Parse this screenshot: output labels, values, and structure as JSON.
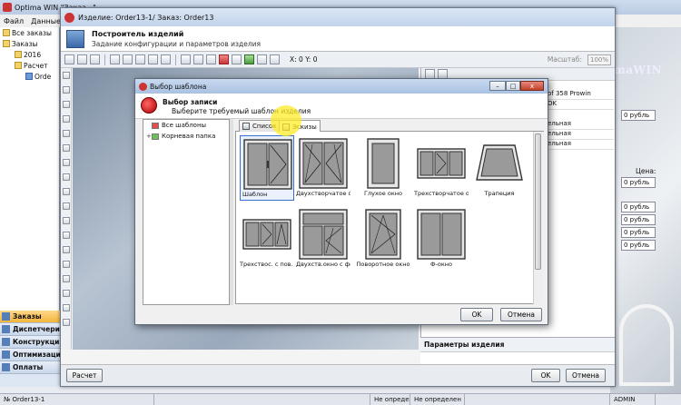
{
  "app": {
    "title": "Optima WIN \"Заказ...\"",
    "menu": [
      "Файл",
      "Данные"
    ],
    "tree": [
      "Все заказы",
      "Заказы",
      "2016",
      "Расчет",
      "Orde"
    ],
    "nav": [
      "Заказы",
      "Диспетчериза",
      "Конструкция",
      "Оптимизация",
      "Оплаты"
    ],
    "status": [
      "№ Order13-1",
      "Не определен",
      "Не определен",
      "ADMIN"
    ],
    "brand": "maWIN"
  },
  "builder": {
    "title": "Изделие: Order13-1/ Заказ: Order13",
    "header_title": "Построитель изделий",
    "header_subtitle": "Задание конфигурации и параметров изделия",
    "coords": "X: 0  Y: 0",
    "zoom_label": "Масштаб:",
    "zoom_value": "100%",
    "props": [
      "of 358 Prowin",
      "OK",
      "ельная",
      "ельная",
      "ельная"
    ],
    "price_label": "Цена:",
    "prices": [
      "0 рубль",
      "0 рубль",
      "0 рубль",
      "0 рубль",
      "0 рубль"
    ],
    "price_top": "0 рубль",
    "params_title": "Параметры изделия",
    "calc_button": "Расчет",
    "ok_button": "OK",
    "cancel_button": "Отмена"
  },
  "dialog": {
    "title": "Выбор шаблона",
    "header_title": "Выбор записи",
    "header_subtitle": "Выберите требуемый шаблон изделия",
    "tree": [
      "Все шаблоны",
      "Корневая папка"
    ],
    "tabs": [
      "Список",
      "Эскизы"
    ],
    "templates": [
      "Шаблон",
      "Двухстворчатое окно",
      "Глухое окно",
      "Трехстворчатое окно",
      "Трапеция",
      "Трехствос. с пов. шт.",
      "Двухств.окно с форт.",
      "Поворотное окно",
      "Ф-окно"
    ],
    "ok_button": "OK",
    "cancel_button": "Отмена",
    "close_glyph": "x",
    "min_glyph": "–",
    "max_glyph": "□"
  }
}
